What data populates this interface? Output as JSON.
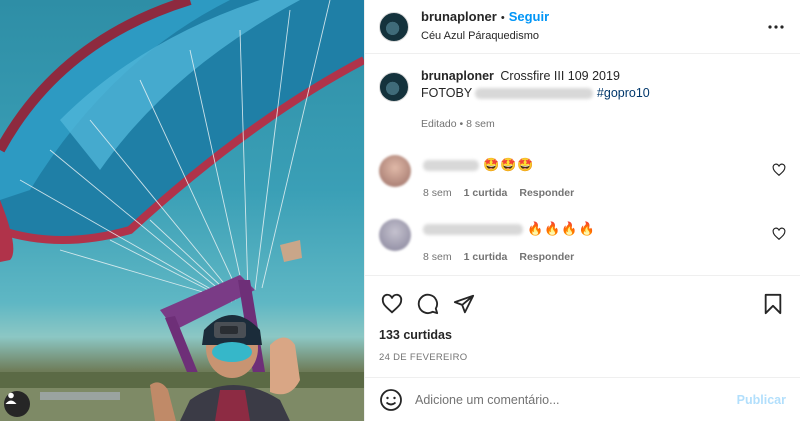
{
  "post": {
    "username": "brunaploner",
    "follow_label": "Seguir",
    "separator": "•",
    "location": "Céu Azul Páraquedismo"
  },
  "caption": {
    "username": "brunaploner",
    "text": "Crossfire III 109 2019",
    "line2_prefix": "FOTOBY",
    "hashtag": "#gopro10",
    "edited": "Editado",
    "sep": "•",
    "time": "8 sem"
  },
  "comments": [
    {
      "emoji": "🤩🤩🤩",
      "time": "8 sem",
      "likes": "1 curtida",
      "reply": "Responder",
      "avatar_color": "#c9a8a0"
    },
    {
      "emoji": "🔥🔥🔥🔥",
      "time": "8 sem",
      "likes": "1 curtida",
      "reply": "Responder",
      "avatar_color": "#a7a4b2"
    }
  ],
  "stats": {
    "likes": "133 curtidas",
    "date": "24 DE FEVEREIRO"
  },
  "composer": {
    "placeholder": "Adicione um comentário...",
    "publish": "Publicar"
  },
  "icons": {
    "more": "more-options-icon",
    "like": "heart-icon",
    "comment": "comment-icon",
    "share": "send-icon",
    "save": "bookmark-icon",
    "emoji": "emoji-icon",
    "tags": "user-tag-icon"
  },
  "colors": {
    "accent": "#0095f6",
    "hashtag": "#00376b",
    "muted": "#737373",
    "publish_disabled": "#b2dffc"
  }
}
